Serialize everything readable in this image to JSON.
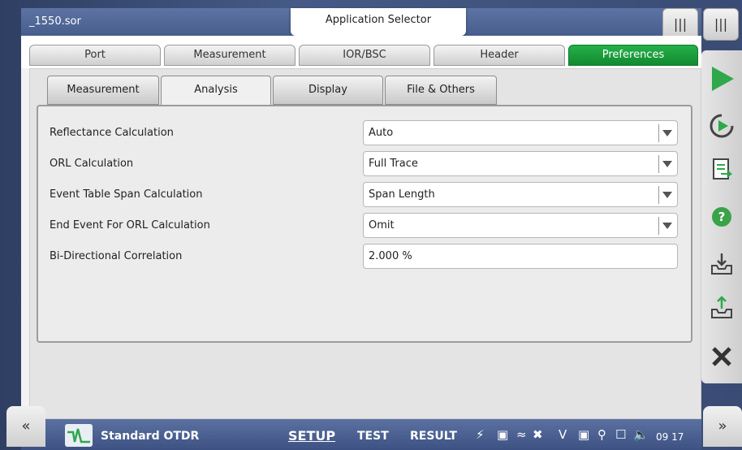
{
  "window": {
    "file_name": "_1550.sor",
    "app_selector": "Application Selector"
  },
  "top_tabs": [
    {
      "label": "Port",
      "active": false
    },
    {
      "label": "Measurement",
      "active": false
    },
    {
      "label": "IOR/BSC",
      "active": false
    },
    {
      "label": "Header",
      "active": false
    },
    {
      "label": "Preferences",
      "active": true
    }
  ],
  "sub_tabs": [
    {
      "label": "Measurement",
      "active": false
    },
    {
      "label": "Analysis",
      "active": true
    },
    {
      "label": "Display",
      "active": false
    },
    {
      "label": "File & Others",
      "active": false
    }
  ],
  "settings": [
    {
      "label": "Reflectance Calculation",
      "value": "Auto",
      "type": "dropdown"
    },
    {
      "label": "ORL Calculation",
      "value": "Full Trace",
      "type": "dropdown"
    },
    {
      "label": "Event Table Span Calculation",
      "value": "Span Length",
      "type": "dropdown"
    },
    {
      "label": "End Event For ORL Calculation",
      "value": "Omit",
      "type": "dropdown"
    },
    {
      "label": "Bi-Directional Correlation",
      "value": "2.000 %",
      "type": "input"
    }
  ],
  "sidebar": {
    "buttons": [
      "play-icon",
      "continuous-icon",
      "report-icon",
      "help-icon",
      "import-icon",
      "export-icon",
      "close-icon"
    ],
    "help_label": "?",
    "handle_label": "|||"
  },
  "bottom": {
    "left_handle": "«",
    "right_handle": "»",
    "app_name": "Standard OTDR",
    "modes": [
      "SETUP",
      "TEST",
      "RESULT"
    ],
    "active_mode": "SETUP",
    "time": "09 17"
  },
  "colors": {
    "accent_green": "#1a9b3c",
    "frame_blue": "#4a5f8f"
  }
}
